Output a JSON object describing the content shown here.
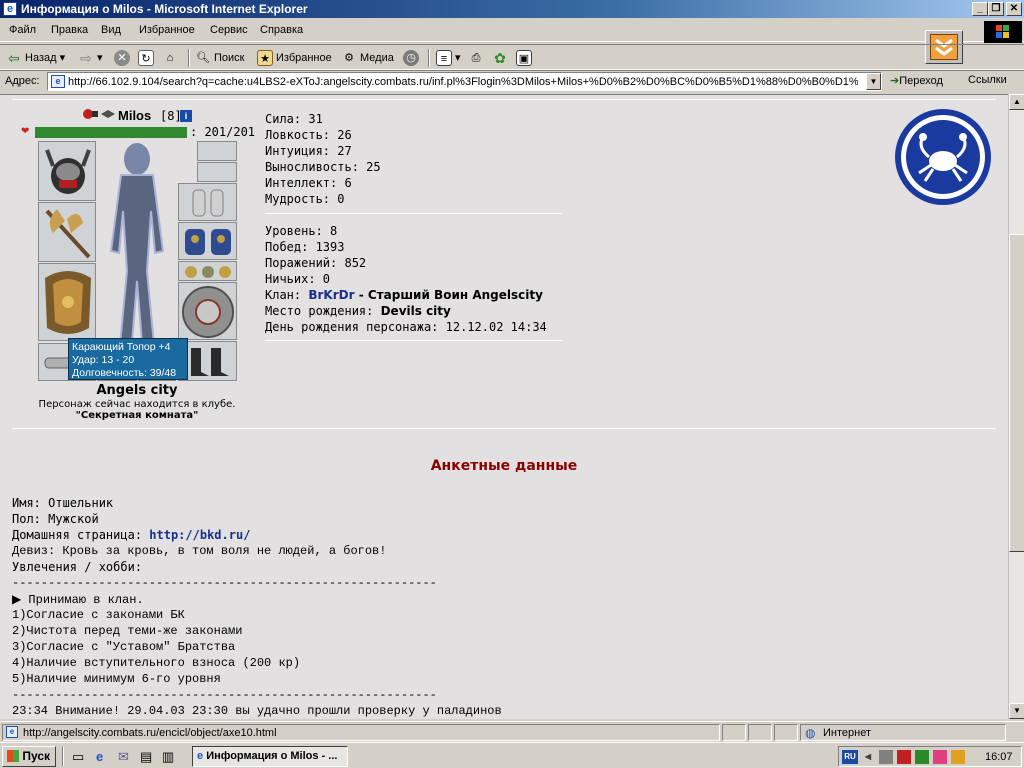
{
  "window": {
    "title": "Информация о Milos - Microsoft Internet Explorer"
  },
  "menu": [
    "Файл",
    "Правка",
    "Вид",
    "Избранное",
    "Сервис",
    "Справка"
  ],
  "toolbar": {
    "back": "Назад",
    "search": "Поиск",
    "favorites": "Избранное",
    "media": "Медиа"
  },
  "address": {
    "label": "Адрес:",
    "url": "http://66.102.9.104/search?q=cache:u4LBS2-eXToJ:angelscity.combats.ru/inf.pl%3Flogin%3DMilos+Milos+%D0%B2%D0%BC%D0%B5%D1%88%D0%B0%D1%8",
    "go": "Переход",
    "links": "Ссылки"
  },
  "character": {
    "name": "Milos",
    "level": "[8]",
    "hp": ": 201/201",
    "hp_fraction": 1.0,
    "city": "Angels city",
    "location_text": "Персонаж сейчас находится в клубе.",
    "room": "\"Секретная комната\"",
    "tooltip": [
      "Карающий Топор +4",
      "Удар: 13 - 20",
      "Долговечность: 39/48"
    ]
  },
  "stats": [
    {
      "label": "Сила: ",
      "value": "31"
    },
    {
      "label": "Ловкость: ",
      "value": "26"
    },
    {
      "label": "Интуиция: ",
      "value": "27"
    },
    {
      "label": "Выносливость: ",
      "value": "25"
    },
    {
      "label": "Интеллект: ",
      "value": "6"
    },
    {
      "label": "Мудрость: ",
      "value": "0"
    }
  ],
  "info": {
    "level": {
      "label": "Уровень: ",
      "value": "8"
    },
    "wins": {
      "label": "Побед: ",
      "value": "1393"
    },
    "losses": {
      "label": "Поражений: ",
      "value": "852"
    },
    "draws": {
      "label": "Ничьих: ",
      "value": "0"
    },
    "clan": {
      "label": "Клан: ",
      "name": "BrKrDr",
      "rank": " - Старший Воин Angelscity"
    },
    "birthplace": {
      "label": "Место рождения: ",
      "value": "Devils city"
    },
    "birthday": {
      "label": "День рождения персонажа: ",
      "value": "12.12.02 14:34"
    }
  },
  "profile": {
    "heading": "Анкетные данные",
    "name": {
      "label": "Имя: ",
      "value": "Отшельник"
    },
    "gender": {
      "label": "Пол: ",
      "value": "Мужской"
    },
    "homepage": {
      "label": "Домашняя страница: ",
      "value": "http://bkd.ru/"
    },
    "motto": "Девиз: Кровь за кровь, в том воля не людей, а богов!",
    "hobby_label": "Увлечения / хобби:",
    "divider": "-----------------------------------------------------------",
    "hobby_lines": [
      "▶ Принимаю в клан.",
      "1)Согласие с законами БК",
      "2)Чистота перед теми-же законами",
      "3)Согласие с \"Уставом\" Братства",
      "4)Наличие вступительного взноса (200 кр)",
      "5)Наличие минимум 6-го уровня"
    ],
    "news": "23:34 Внимание! 29.04.03 23:30 вы удачно прошли проверку у паладинов"
  },
  "status": {
    "url": "http://angelscity.combats.ru/encicl/object/axe10.html",
    "zone": "Интернет"
  },
  "taskbar": {
    "start": "Пуск",
    "task": "Информация о Milos - ...",
    "lang": "RU",
    "time": "16:07"
  },
  "colors": {
    "hp_bar": "#2f8a2f",
    "heading": "#8b0000",
    "link": "#1a2f8a",
    "tooltip": "#1a6aa0"
  }
}
